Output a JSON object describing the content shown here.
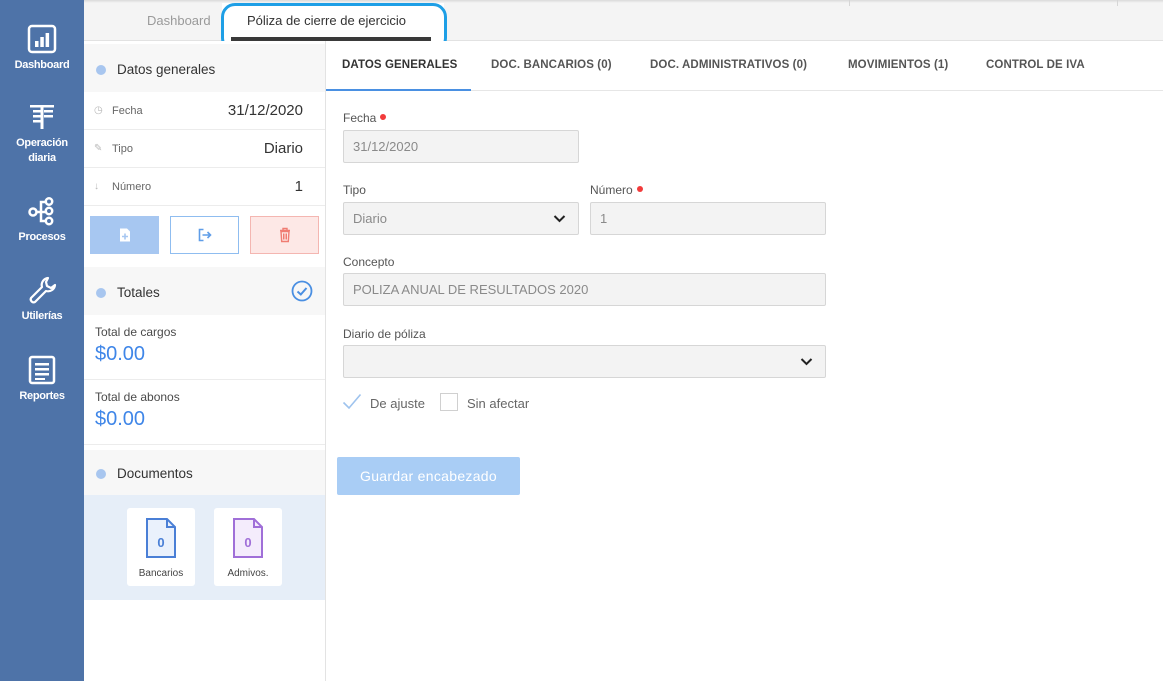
{
  "nav": {
    "items": [
      {
        "label_1": "Dashboard",
        "label_2": ""
      },
      {
        "label_1": "Operación",
        "label_2": "diaria"
      },
      {
        "label_1": "Procesos",
        "label_2": ""
      },
      {
        "label_1": "Utilerías",
        "label_2": ""
      },
      {
        "label_1": "Reportes",
        "label_2": ""
      }
    ]
  },
  "tabs": {
    "dashboard": "Dashboard",
    "active": "Póliza de cierre de ejercicio"
  },
  "summary": {
    "datos_generales": "Datos generales",
    "fecha_label": "Fecha",
    "fecha_value": "31/12/2020",
    "tipo_label": "Tipo",
    "tipo_value": "Diario",
    "numero_label": "Número",
    "numero_value": "1",
    "totales": "Totales",
    "cargos_label": "Total de cargos",
    "cargos_value": "$0.00",
    "abonos_label": "Total de abonos",
    "abonos_value": "$0.00",
    "documentos": "Documentos",
    "docs": [
      {
        "count": "0",
        "label": "Bancarios",
        "color": "#4a7fd6"
      },
      {
        "count": "0",
        "label": "Admivos.",
        "color": "#a06fd8"
      }
    ]
  },
  "subtabs": [
    "DATOS GENERALES",
    "DOC. BANCARIOS (0)",
    "DOC. ADMINISTRATIVOS (0)",
    "MOVIMIENTOS (1)",
    "CONTROL DE IVA"
  ],
  "form": {
    "fecha_label": "Fecha",
    "fecha_value": "31/12/2020",
    "tipo_label": "Tipo",
    "tipo_value": "Diario",
    "numero_label": "Número",
    "numero_value": "1",
    "concepto_label": "Concepto",
    "concepto_value": "POLIZA ANUAL DE RESULTADOS 2020",
    "diario_label": "Diario de póliza",
    "diario_value": "",
    "de_ajuste": "De ajuste",
    "de_ajuste_checked": true,
    "sin_afectar": "Sin afectar",
    "sin_afectar_checked": false,
    "save_label": "Guardar encabezado"
  },
  "colors": {
    "nav_bg": "#4e73a8",
    "accent": "#4a90e2",
    "amount": "#3f86e8",
    "required": "#f23b3b",
    "highlight": "#1e9fe6"
  }
}
